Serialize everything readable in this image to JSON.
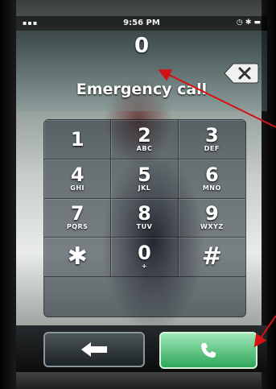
{
  "status_bar": {
    "time": "9:56 PM",
    "signal": "▪▪▪",
    "icons": "◷ ✱ ▬"
  },
  "dialer": {
    "number": "0",
    "emergency_label": "Emergency call",
    "keys": [
      {
        "digit": "1",
        "letters": ""
      },
      {
        "digit": "2",
        "letters": "ABC"
      },
      {
        "digit": "3",
        "letters": "DEF"
      },
      {
        "digit": "4",
        "letters": "GHI"
      },
      {
        "digit": "5",
        "letters": "JKL"
      },
      {
        "digit": "6",
        "letters": "MNO"
      },
      {
        "digit": "7",
        "letters": "PQRS"
      },
      {
        "digit": "8",
        "letters": "TUV"
      },
      {
        "digit": "9",
        "letters": "WXYZ"
      },
      {
        "digit": "✱",
        "letters": ""
      },
      {
        "digit": "0",
        "letters": "+"
      },
      {
        "digit": "#",
        "letters": ""
      }
    ]
  },
  "icons": {
    "backspace": "backspace-icon",
    "back": "left-arrow-icon",
    "call": "phone-icon"
  },
  "colors": {
    "call_button": "#2ea75b",
    "annotation_arrow": "#d31212"
  }
}
